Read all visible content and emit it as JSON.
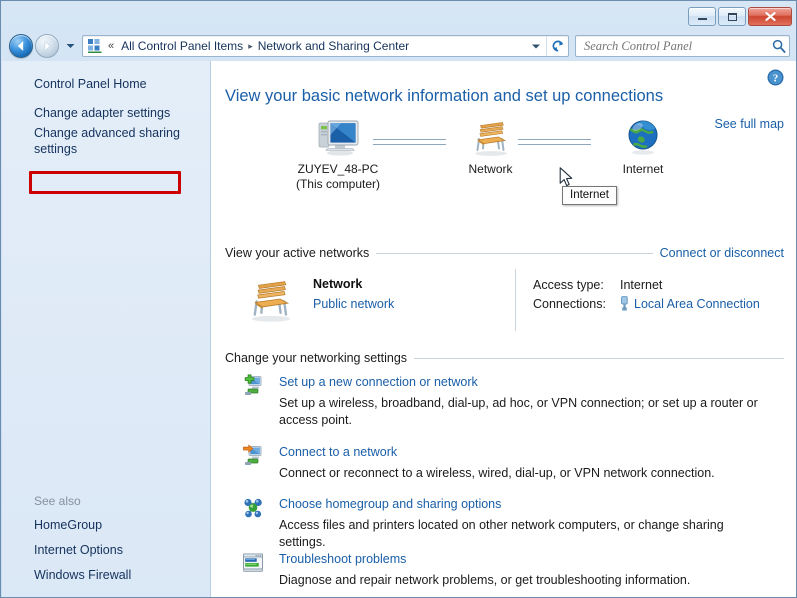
{
  "window": {
    "title": "Network and Sharing Center",
    "controls": {
      "minimize_label": "Minimize",
      "maximize_label": "Maximize",
      "close_label": "Close"
    }
  },
  "addressbar": {
    "back_label": "Back",
    "forward_label": "Forward",
    "recent_pages_label": "Recent pages",
    "previous_locations_label": "Previous Locations",
    "refresh_label": "Refresh",
    "overflow_chevrons": "«",
    "separator": "▸",
    "crumbs": [
      {
        "label": "All Control Panel Items"
      },
      {
        "label": "Network and Sharing Center"
      }
    ]
  },
  "search": {
    "placeholder": "Search Control Panel",
    "value": "",
    "icon": "search-icon"
  },
  "sidebar": {
    "home_label": "Control Panel Home",
    "links": [
      {
        "label": "Change adapter settings",
        "highlighted": true
      },
      {
        "label": "Change advanced sharing settings",
        "highlighted": false
      }
    ],
    "highlight_color": "#cc0000",
    "see_also": {
      "title": "See also",
      "items": [
        {
          "label": "HomeGroup"
        },
        {
          "label": "Internet Options"
        },
        {
          "label": "Windows Firewall"
        }
      ]
    }
  },
  "main": {
    "help_label": "Help",
    "title": "View your basic network information and set up connections",
    "see_full_map": "See full map",
    "network_map": {
      "nodes": [
        {
          "icon": "computer-icon",
          "label": "ZUYEV_48-PC",
          "sublabel": "(This computer)"
        },
        {
          "icon": "bench-icon",
          "label": "Network",
          "sublabel": ""
        },
        {
          "icon": "globe-icon",
          "label": "Internet",
          "sublabel": ""
        }
      ]
    },
    "active_networks": {
      "heading": "View your active networks",
      "action_link": "Connect or disconnect",
      "network": {
        "icon": "bench-icon",
        "name": "Network",
        "type": "Public network",
        "details": [
          {
            "label": "Access type:",
            "value": "Internet",
            "is_link": false,
            "icon": ""
          },
          {
            "label": "Connections:",
            "value": "Local Area Connection",
            "is_link": true,
            "icon": "ethernet-plug-icon"
          }
        ]
      }
    },
    "settings_section": {
      "heading": "Change your networking settings",
      "items": [
        {
          "icon": "new-connection-icon",
          "title": "Set up a new connection or network",
          "desc": "Set up a wireless, broadband, dial-up, ad hoc, or VPN connection; or set up a router or access point."
        },
        {
          "icon": "connect-network-icon",
          "title": "Connect to a network",
          "desc": "Connect or reconnect to a wireless, wired, dial-up, or VPN network connection."
        },
        {
          "icon": "homegroup-icon",
          "title": "Choose homegroup and sharing options",
          "desc": "Access files and printers located on other network computers, or change sharing settings."
        },
        {
          "icon": "troubleshoot-icon",
          "title": "Troubleshoot problems",
          "desc": "Diagnose and repair network problems, or get troubleshooting information."
        }
      ]
    }
  },
  "tooltip": {
    "text": "Internet"
  },
  "colors": {
    "link": "#1a5fa8",
    "title": "#1a5fa8",
    "sidebar_link": "#15325c",
    "highlight": "#cc0000",
    "chrome_bg": "#d6e6f5"
  }
}
